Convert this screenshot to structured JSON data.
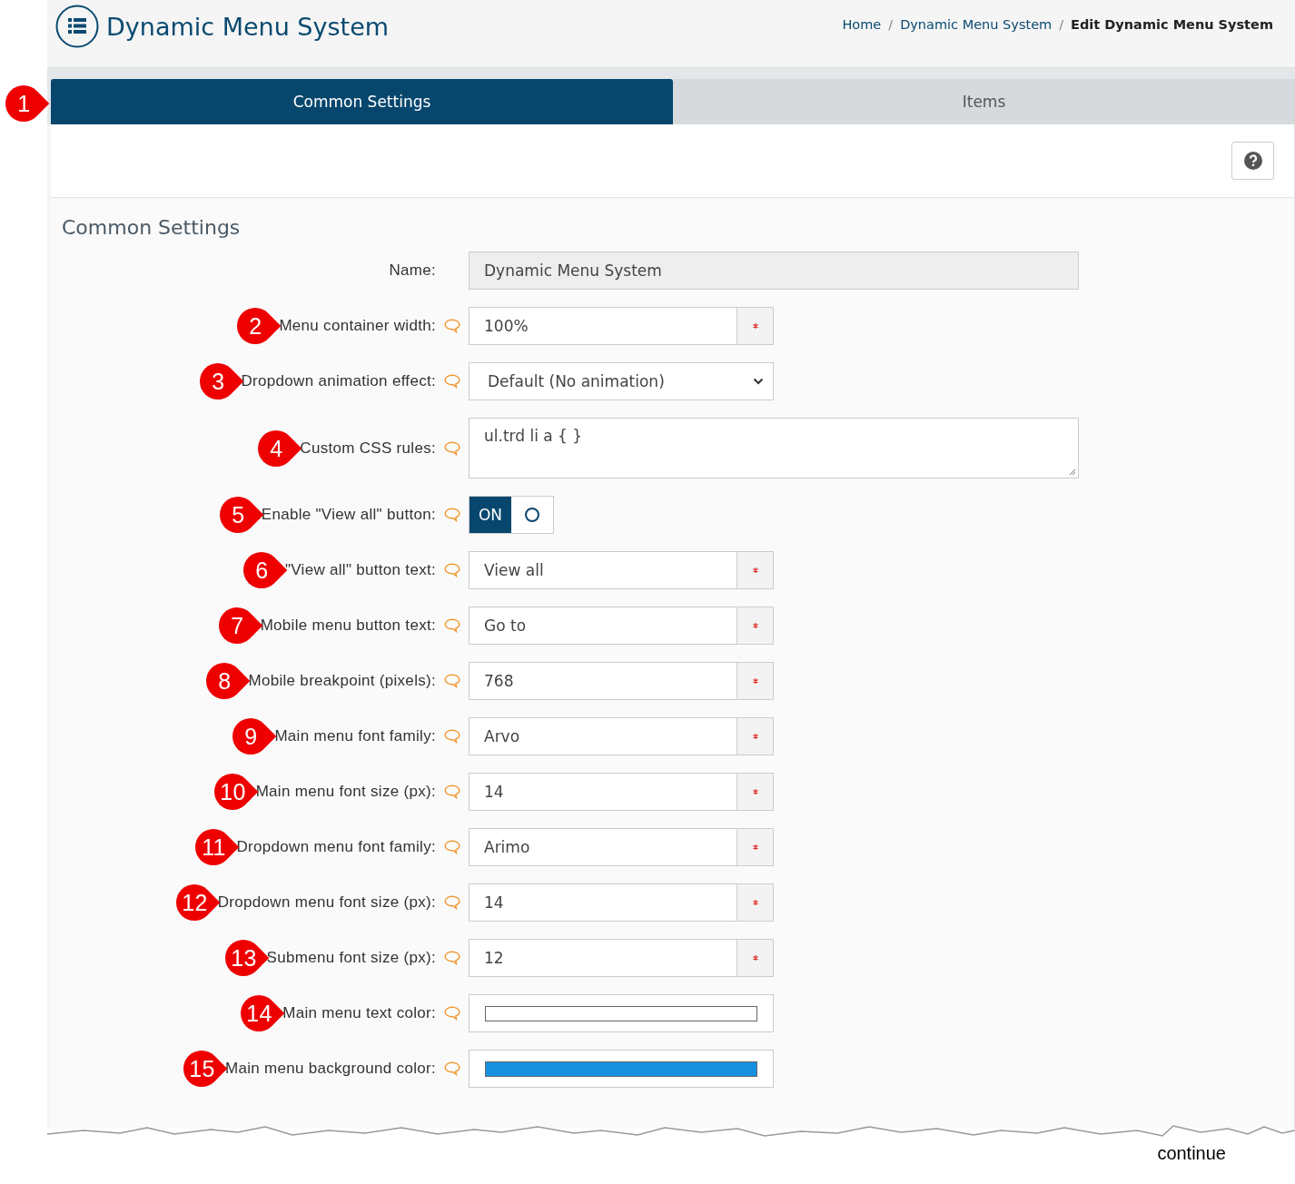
{
  "header": {
    "title": "Dynamic Menu System",
    "breadcrumb_separator": "/",
    "breadcrumbs": [
      {
        "label": "Home",
        "current": false
      },
      {
        "label": "Dynamic Menu System",
        "current": false
      },
      {
        "label": "Edit Dynamic Menu System",
        "current": true
      }
    ]
  },
  "tabs_marker": "1",
  "tabs": [
    {
      "label": "Common Settings",
      "selected": true
    },
    {
      "label": "Items",
      "selected": false
    }
  ],
  "section_title": "Common Settings",
  "fields": [
    {
      "kind": "readonly",
      "label": "Name:",
      "value": "Dynamic Menu System"
    },
    {
      "kind": "text",
      "marker": "2",
      "label": "Menu container width:",
      "value": "100%",
      "required": true
    },
    {
      "kind": "select",
      "marker": "3",
      "label": "Dropdown animation effect:",
      "value": "Default (No animation)"
    },
    {
      "kind": "textarea",
      "marker": "4",
      "label": "Custom CSS rules:",
      "value": "ul.trd li a { }"
    },
    {
      "kind": "toggle",
      "marker": "5",
      "label": "Enable \"View all\" button:",
      "on": true,
      "on_text": "ON"
    },
    {
      "kind": "text",
      "marker": "6",
      "label": "\"View all\" button text:",
      "value": "View all",
      "required": true
    },
    {
      "kind": "text",
      "marker": "7",
      "label": "Mobile menu button text:",
      "value": "Go to",
      "required": true
    },
    {
      "kind": "text",
      "marker": "8",
      "label": "Mobile breakpoint (pixels):",
      "value": "768",
      "required": true
    },
    {
      "kind": "text",
      "marker": "9",
      "label": "Main menu font family:",
      "value": "Arvo",
      "required": true
    },
    {
      "kind": "text",
      "marker": "10",
      "label": "Main menu font size (px):",
      "value": "14",
      "required": true
    },
    {
      "kind": "text",
      "marker": "11",
      "label": "Dropdown menu font family:",
      "value": "Arimo",
      "required": true
    },
    {
      "kind": "text",
      "marker": "12",
      "label": "Dropdown menu font size (px):",
      "value": "14",
      "required": true
    },
    {
      "kind": "text",
      "marker": "13",
      "label": "Submenu font size (px):",
      "value": "12",
      "required": true
    },
    {
      "kind": "color",
      "marker": "14",
      "label": "Main menu text color:",
      "color": "#ffffff"
    },
    {
      "kind": "color",
      "marker": "15",
      "label": "Main menu background color:",
      "color": "#1591e0"
    }
  ],
  "continue_text": "continue"
}
